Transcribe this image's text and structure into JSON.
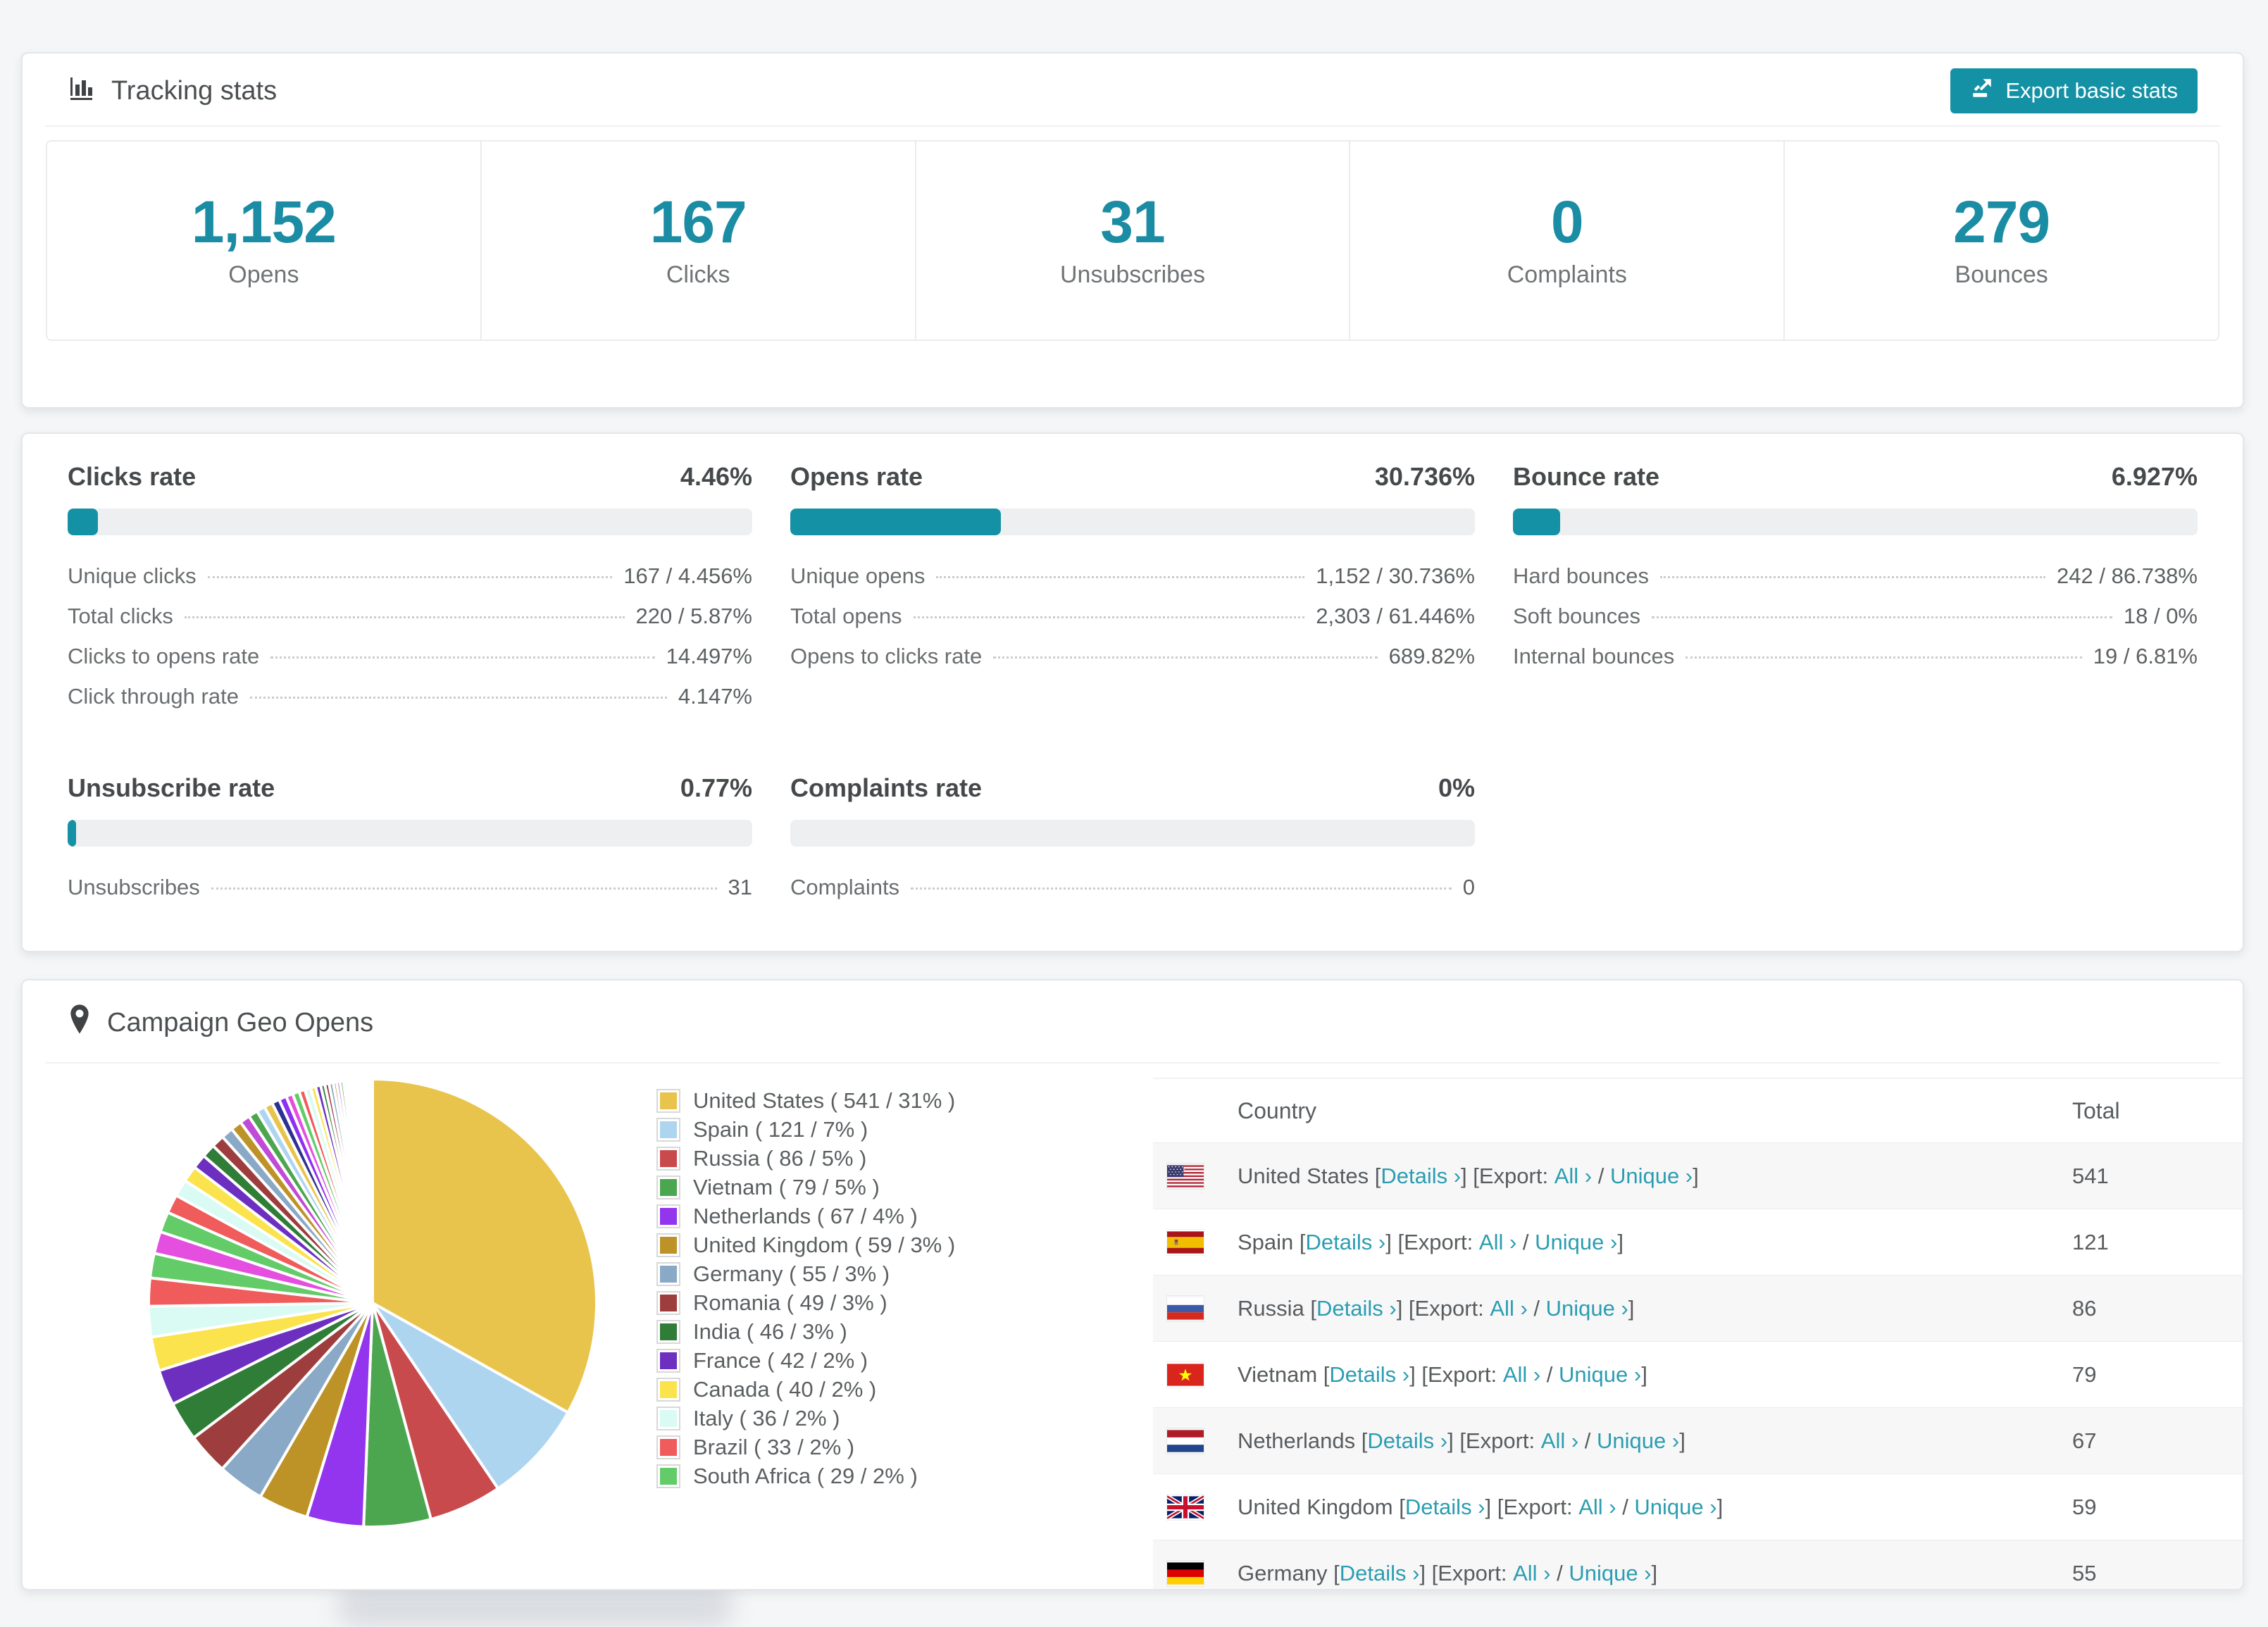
{
  "accent": "#1591a5",
  "link_color": "#2b9db1",
  "tracking": {
    "title": "Tracking stats",
    "export_button": "Export basic stats",
    "stats": [
      {
        "value": "1,152",
        "label": "Opens"
      },
      {
        "value": "167",
        "label": "Clicks"
      },
      {
        "value": "31",
        "label": "Unsubscribes"
      },
      {
        "value": "0",
        "label": "Complaints"
      },
      {
        "value": "279",
        "label": "Bounces"
      }
    ]
  },
  "rates": {
    "panels": [
      {
        "title": "Clicks rate",
        "value": "4.46%",
        "pct": 4.46,
        "rows": [
          {
            "label": "Unique clicks",
            "value": "167 / 4.456%"
          },
          {
            "label": "Total clicks",
            "value": "220 / 5.87%"
          },
          {
            "label": "Clicks to opens rate",
            "value": "14.497%"
          },
          {
            "label": "Click through rate",
            "value": "4.147%"
          }
        ]
      },
      {
        "title": "Opens rate",
        "value": "30.736%",
        "pct": 30.736,
        "rows": [
          {
            "label": "Unique opens",
            "value": "1,152 / 30.736%"
          },
          {
            "label": "Total opens",
            "value": "2,303 / 61.446%"
          },
          {
            "label": "Opens to clicks rate",
            "value": "689.82%"
          }
        ]
      },
      {
        "title": "Bounce rate",
        "value": "6.927%",
        "pct": 6.927,
        "rows": [
          {
            "label": "Hard bounces",
            "value": "242 / 86.738%"
          },
          {
            "label": "Soft bounces",
            "value": "18 / 0%"
          },
          {
            "label": "Internal bounces",
            "value": "19 / 6.81%"
          }
        ]
      },
      {
        "title": "Unsubscribe rate",
        "value": "0.77%",
        "pct": 0.77,
        "rows": [
          {
            "label": "Unsubscribes",
            "value": "31"
          }
        ]
      },
      {
        "title": "Complaints rate",
        "value": "0%",
        "pct": 0,
        "rows": [
          {
            "label": "Complaints",
            "value": "0"
          }
        ]
      }
    ]
  },
  "geo": {
    "title": "Campaign Geo Opens",
    "table": {
      "columns": [
        "Country",
        "Total"
      ],
      "details_label": "Details",
      "export_label": "Export:",
      "all_label": "All",
      "unique_label": "Unique",
      "rows": [
        {
          "country": "United States",
          "flag": "us",
          "total": "541"
        },
        {
          "country": "Spain",
          "flag": "es",
          "total": "121"
        },
        {
          "country": "Russia",
          "flag": "ru",
          "total": "86"
        },
        {
          "country": "Vietnam",
          "flag": "vn",
          "total": "79"
        },
        {
          "country": "Netherlands",
          "flag": "nl",
          "total": "67"
        },
        {
          "country": "United Kingdom",
          "flag": "gb",
          "total": "59"
        },
        {
          "country": "Germany",
          "flag": "de",
          "total": "55",
          "partial": true
        }
      ]
    }
  },
  "chart_data": {
    "type": "pie",
    "title": "Campaign Geo Opens",
    "legend_position": "right-of-pie",
    "start_angle_deg": -90,
    "direction": "clockwise",
    "slices": [
      {
        "label": "United States",
        "value": 541,
        "pct": 31,
        "color": "#e9c44c"
      },
      {
        "label": "Spain",
        "value": 121,
        "pct": 7,
        "color": "#aed5f0"
      },
      {
        "label": "Russia",
        "value": 86,
        "pct": 5,
        "color": "#c94a4d"
      },
      {
        "label": "Vietnam",
        "value": 79,
        "pct": 5,
        "color": "#4ca64f"
      },
      {
        "label": "Netherlands",
        "value": 67,
        "pct": 4,
        "color": "#9334ee"
      },
      {
        "label": "United Kingdom",
        "value": 59,
        "pct": 3,
        "color": "#bd9327"
      },
      {
        "label": "Germany",
        "value": 55,
        "pct": 3,
        "color": "#89a9c7"
      },
      {
        "label": "Romania",
        "value": 49,
        "pct": 3,
        "color": "#9e3d3d"
      },
      {
        "label": "India",
        "value": 46,
        "pct": 3,
        "color": "#2f7d36"
      },
      {
        "label": "France",
        "value": 42,
        "pct": 2,
        "color": "#6c2fc0"
      },
      {
        "label": "Canada",
        "value": 40,
        "pct": 2,
        "color": "#fbe34d"
      },
      {
        "label": "Italy",
        "value": 36,
        "pct": 2,
        "color": "#d9fbf3"
      },
      {
        "label": "Brazil",
        "value": 33,
        "pct": 2,
        "color": "#f05b5b"
      },
      {
        "label": "South Africa",
        "value": 29,
        "pct": 2,
        "color": "#63cc68"
      }
    ],
    "unlabeled_tail_values": [
      26,
      24,
      22,
      20,
      19,
      17,
      16,
      15,
      14,
      13,
      12,
      11,
      10,
      10,
      9,
      9,
      8,
      8,
      7,
      7,
      6,
      6,
      5,
      5,
      5,
      4,
      4,
      4,
      3,
      3,
      3,
      3,
      2,
      2,
      2,
      2,
      2,
      2,
      1,
      1,
      1,
      1,
      1,
      1,
      1,
      1,
      1,
      1
    ],
    "legend_item_format": "{label} ( {value} / {pct}% )"
  }
}
